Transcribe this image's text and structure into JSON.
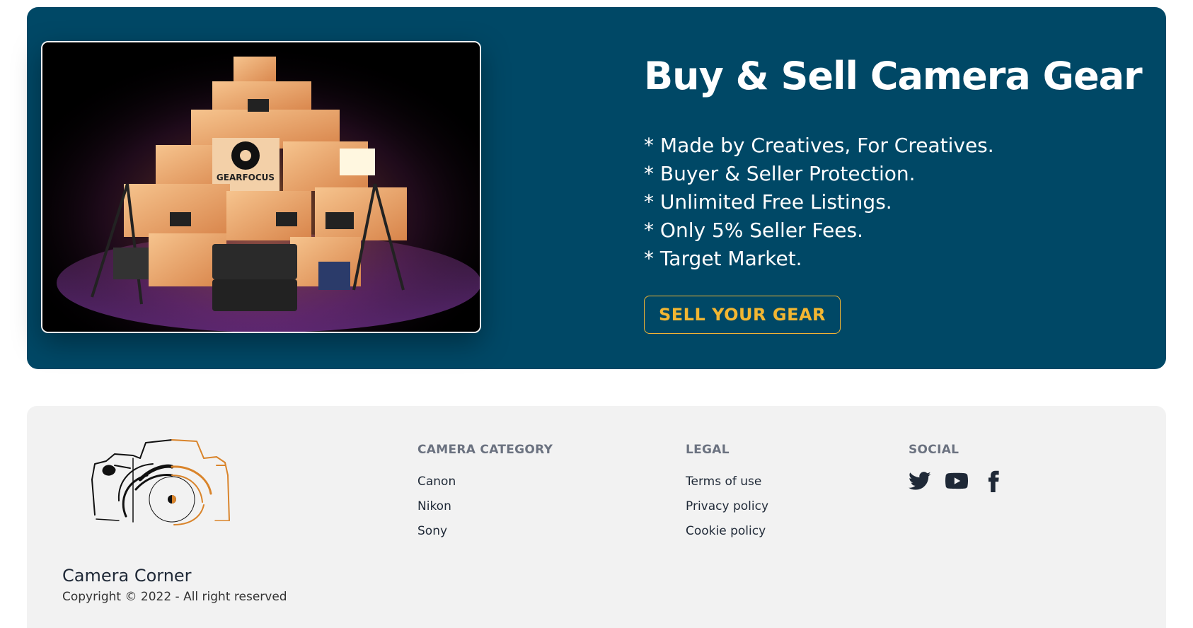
{
  "hero": {
    "title": "Buy & Sell Camera Gear",
    "features": [
      "Made by Creatives, For Creatives.",
      "Buyer & Seller Protection.",
      "Unlimited Free Listings.",
      "Only 5% Seller Fees.",
      "Target Market."
    ],
    "cta_label": "SELL YOUR GEAR",
    "image_brand_text": "GEARFOCUS",
    "colors": {
      "background": "#004866",
      "cta": "#f2b632",
      "text": "#ffffff"
    }
  },
  "footer": {
    "brand_name": "Camera Corner",
    "copyright": "Copyright © 2022 - All right reserved",
    "columns": [
      {
        "title": "CAMERA CATEGORY",
        "links": [
          "Canon",
          "Nikon",
          "Sony"
        ]
      },
      {
        "title": "LEGAL",
        "links": [
          "Terms of use",
          "Privacy policy",
          "Cookie policy"
        ]
      },
      {
        "title": "SOCIAL",
        "icons": [
          "twitter-icon",
          "youtube-icon",
          "facebook-icon"
        ]
      }
    ],
    "colors": {
      "background": "#f2f2f2",
      "logo_accent": "#d9842b"
    }
  }
}
